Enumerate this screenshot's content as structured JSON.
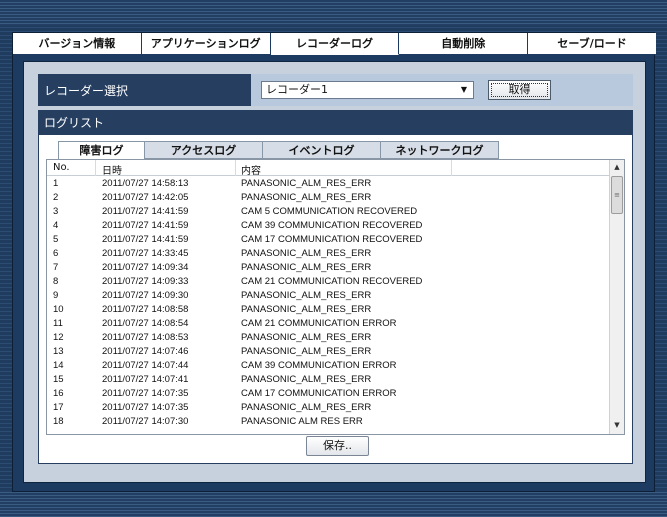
{
  "main_tabs": [
    "バージョン情報",
    "アプリケーションログ",
    "レコーダーログ",
    "自動削除",
    "セーブ/ロード"
  ],
  "active_main_tab": 2,
  "recorder": {
    "label": "レコーダー選択",
    "selected": "レコーダー1",
    "get_button": "取得"
  },
  "loglist": {
    "label": "ログリスト"
  },
  "sub_tabs": [
    "障害ログ",
    "アクセスログ",
    "イベントログ",
    "ネットワークログ"
  ],
  "columns": [
    "No.",
    "日時",
    "内容"
  ],
  "rows": [
    {
      "no": "1",
      "dt": "2011/07/27 14:58:13",
      "content": "PANASONIC_ALM_RES_ERR"
    },
    {
      "no": "2",
      "dt": "2011/07/27 14:42:05",
      "content": "PANASONIC_ALM_RES_ERR"
    },
    {
      "no": "3",
      "dt": "2011/07/27 14:41:59",
      "content": "CAM 5 COMMUNICATION RECOVERED"
    },
    {
      "no": "4",
      "dt": "2011/07/27 14:41:59",
      "content": "CAM 39 COMMUNICATION RECOVERED"
    },
    {
      "no": "5",
      "dt": "2011/07/27 14:41:59",
      "content": "CAM 17 COMMUNICATION RECOVERED"
    },
    {
      "no": "6",
      "dt": "2011/07/27 14:33:45",
      "content": "PANASONIC_ALM_RES_ERR"
    },
    {
      "no": "7",
      "dt": "2011/07/27 14:09:34",
      "content": "PANASONIC_ALM_RES_ERR"
    },
    {
      "no": "8",
      "dt": "2011/07/27 14:09:33",
      "content": "CAM 21 COMMUNICATION RECOVERED"
    },
    {
      "no": "9",
      "dt": "2011/07/27 14:09:30",
      "content": "PANASONIC_ALM_RES_ERR"
    },
    {
      "no": "10",
      "dt": "2011/07/27 14:08:58",
      "content": "PANASONIC_ALM_RES_ERR"
    },
    {
      "no": "11",
      "dt": "2011/07/27 14:08:54",
      "content": "CAM 21 COMMUNICATION ERROR"
    },
    {
      "no": "12",
      "dt": "2011/07/27 14:08:53",
      "content": "PANASONIC_ALM_RES_ERR"
    },
    {
      "no": "13",
      "dt": "2011/07/27 14:07:46",
      "content": "PANASONIC_ALM_RES_ERR"
    },
    {
      "no": "14",
      "dt": "2011/07/27 14:07:44",
      "content": "CAM 39 COMMUNICATION ERROR"
    },
    {
      "no": "15",
      "dt": "2011/07/27 14:07:41",
      "content": "PANASONIC_ALM_RES_ERR"
    },
    {
      "no": "16",
      "dt": "2011/07/27 14:07:35",
      "content": "CAM 17 COMMUNICATION ERROR"
    },
    {
      "no": "17",
      "dt": "2011/07/27 14:07:35",
      "content": "PANASONIC_ALM_RES_ERR"
    },
    {
      "no": "18",
      "dt": "2011/07/27 14:07:30",
      "content": "PANASONIC ALM RES ERR"
    }
  ],
  "save_button": "保存..",
  "icons": {
    "dropdown": "chevron-down-icon",
    "scroll_up": "arrow-up-icon",
    "scroll_down": "arrow-down-icon",
    "scroll_thumb": "grip-icon"
  }
}
